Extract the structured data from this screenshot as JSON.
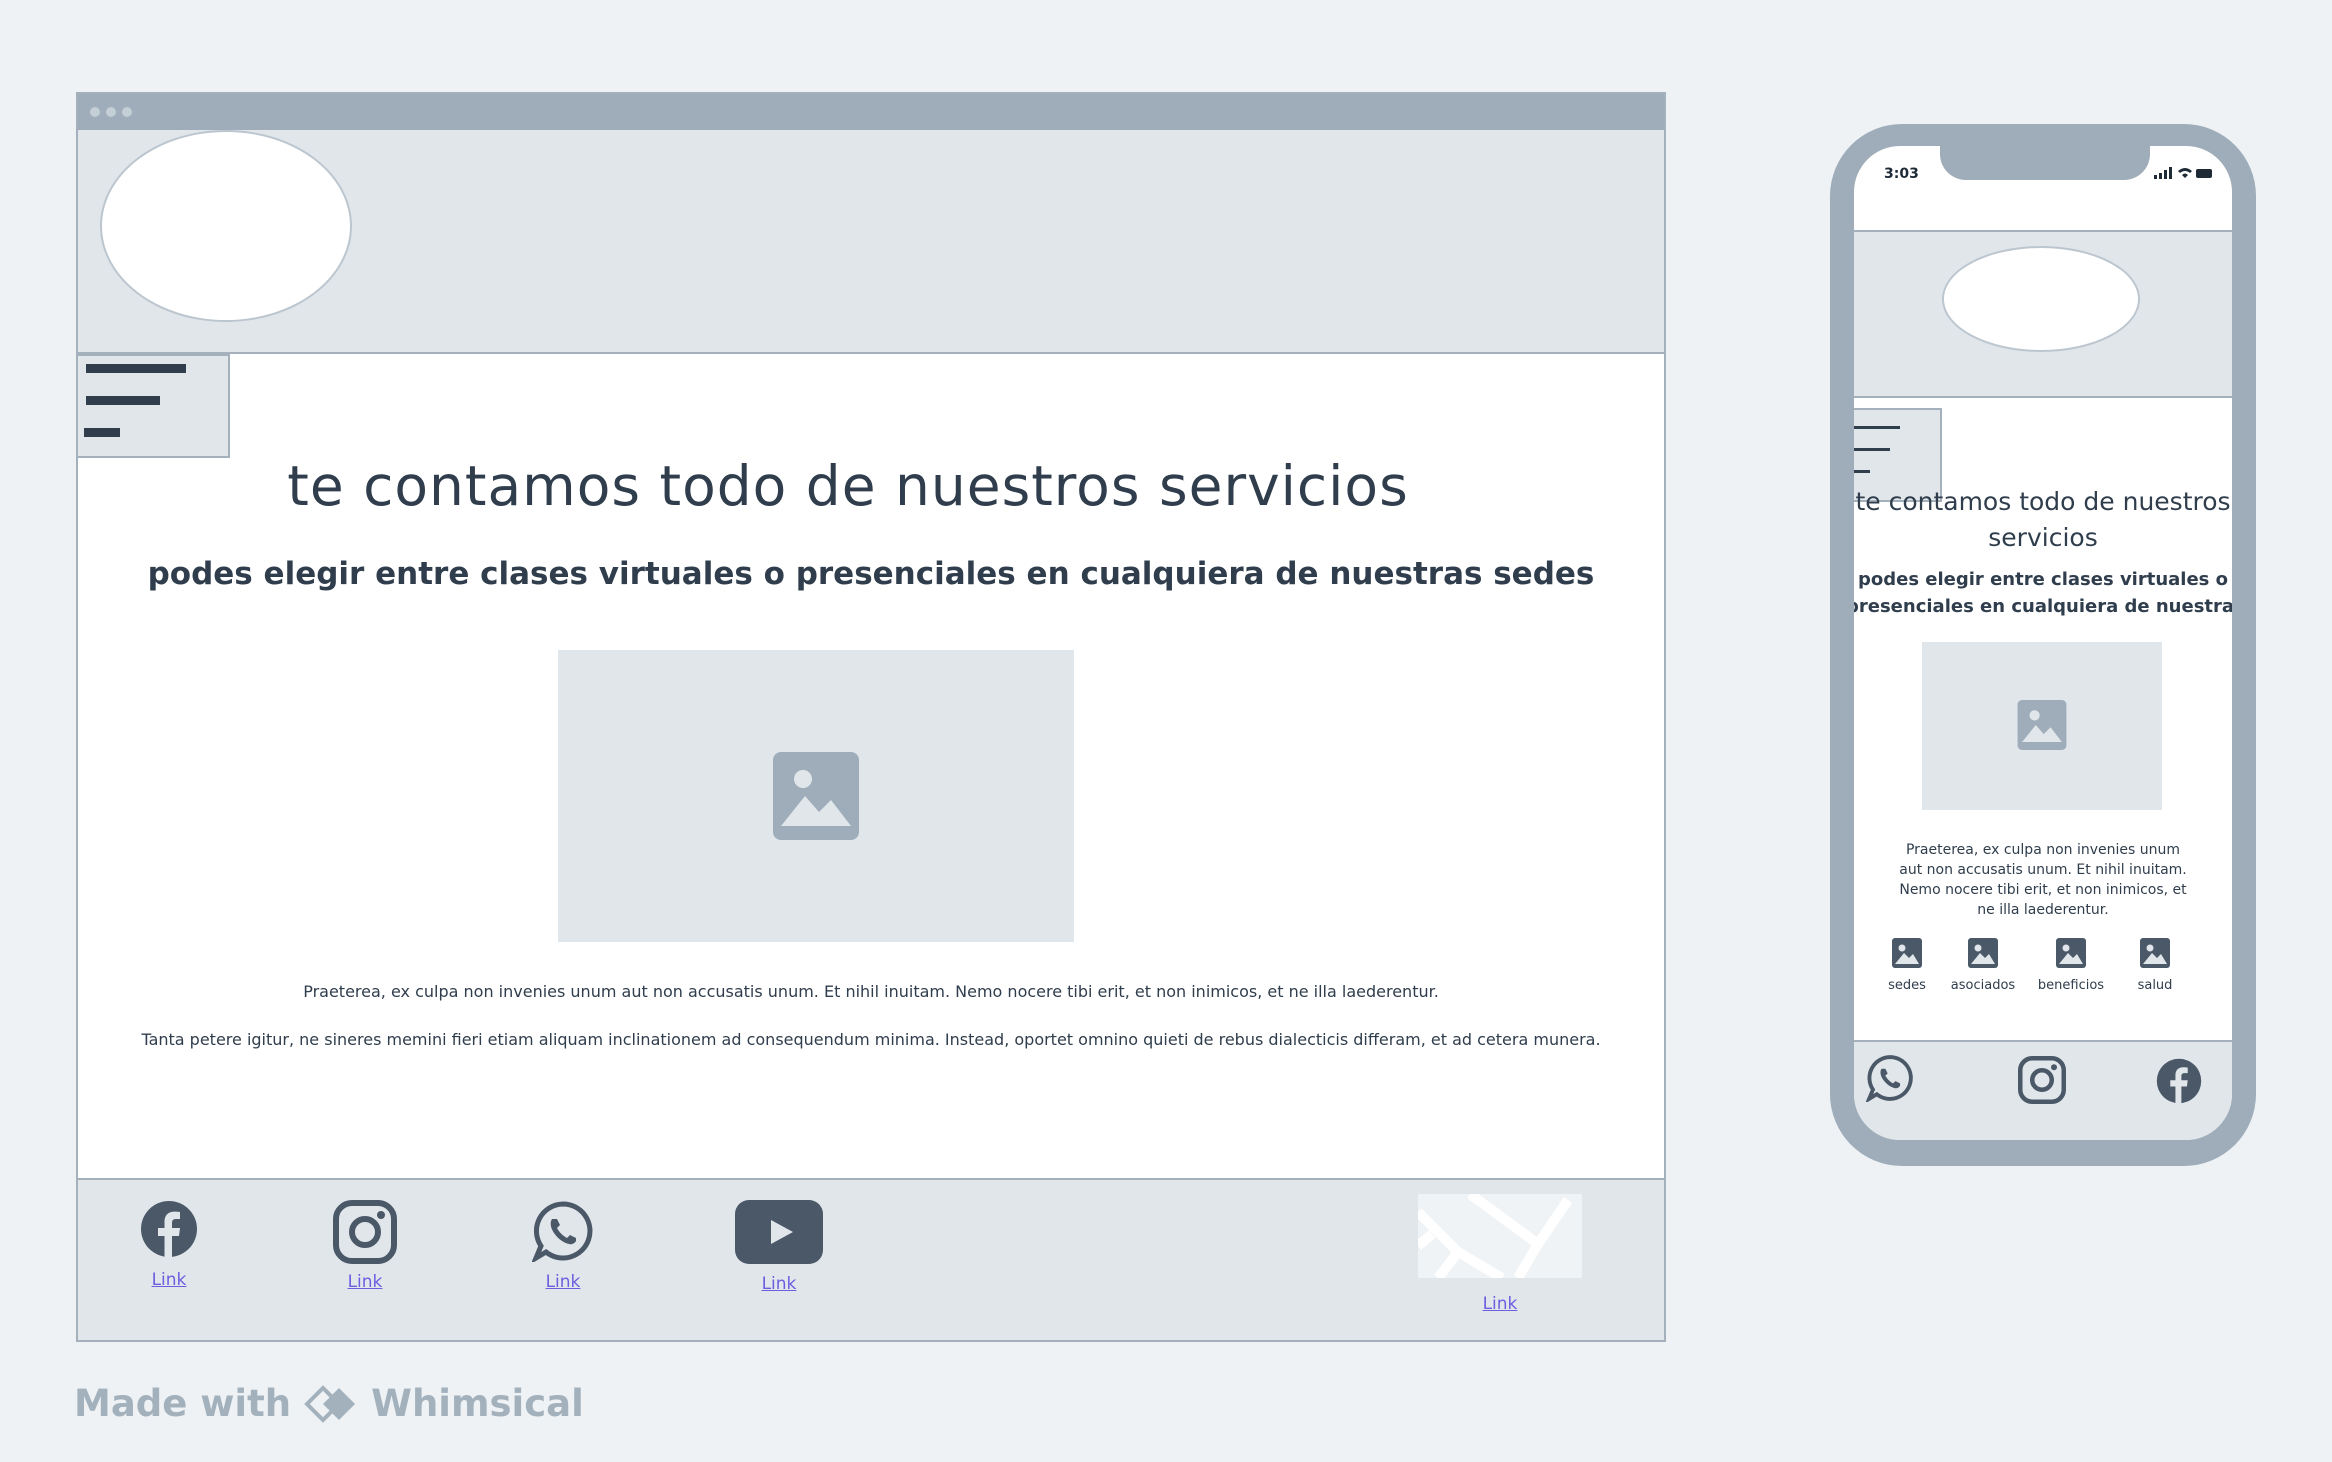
{
  "desktop": {
    "title": "te contamos todo de nuestros servicios",
    "subtitle": "podes elegir entre clases virtuales o presenciales en cualquiera de nuestras sedes",
    "paragraphs": [
      "Praeterea, ex culpa non invenies unum aut non accusatis unum. Et nihil inuitam. Nemo nocere tibi erit, et non inimicos, et ne illa laederentur.",
      "Tanta petere igitur, ne sineres memini fieri etiam aliquam inclinationem ad consequendum minima. Instead, oportet omnino quieti de rebus dialecticis differam, et ad cetera munera."
    ],
    "footer_links": [
      {
        "icon": "facebook-icon",
        "label": "Link"
      },
      {
        "icon": "instagram-icon",
        "label": "Link"
      },
      {
        "icon": "whatsapp-icon",
        "label": "Link"
      },
      {
        "icon": "youtube-icon",
        "label": "Link"
      },
      {
        "icon": "map-icon",
        "label": "Link"
      }
    ]
  },
  "phone": {
    "time": "3:03",
    "title": "te contamos todo de nuestros servicios",
    "subtitle_line1": "podes elegir entre clases virtuales o",
    "subtitle_line2": "presenciales en cualquiera de nuestras sedes",
    "paragraph": "Praeterea, ex culpa non invenies unum aut non accusatis unum. Et nihil inuitam. Nemo nocere tibi erit, et non inimicos, et ne illa laederentur.",
    "nav_items": [
      "sedes",
      "asociados",
      "beneficios",
      "salud"
    ],
    "footer_icons": [
      "whatsapp-icon",
      "instagram-icon",
      "facebook-icon"
    ]
  },
  "watermark": {
    "prefix": "Made with",
    "brand": "Whimsical"
  },
  "colors": {
    "frame": "#9eadb9",
    "panel": "#e1e6eb",
    "text": "#2f3d4c",
    "link": "#6b5fe0",
    "background": "#eef2f5"
  }
}
